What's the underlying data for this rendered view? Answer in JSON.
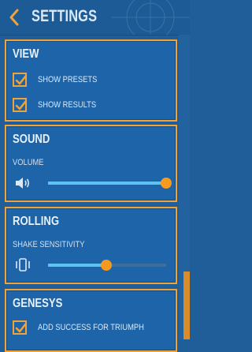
{
  "header": {
    "title": "SETTINGS",
    "back_icon": "chevron-left-icon"
  },
  "colors": {
    "accent": "#f0a33a",
    "background": "#1f5e99",
    "slider_fill": "#5fc3f2",
    "thumb": "#f59a1f"
  },
  "sections": {
    "view": {
      "title": "VIEW",
      "show_presets": {
        "label": "SHOW PRESETS",
        "checked": true
      },
      "show_results": {
        "label": "SHOW RESULTS",
        "checked": true
      }
    },
    "sound": {
      "title": "SOUND",
      "volume_label": "VOLUME",
      "volume_icon": "speaker-icon",
      "volume_value": 1.0
    },
    "rolling": {
      "title": "ROLLING",
      "shake_label": "SHAKE SENSITIVITY",
      "shake_icon": "shaking-phone-icon",
      "shake_value": 0.49
    },
    "genesys": {
      "title": "GENESYS",
      "add_success": {
        "label": "ADD SUCCESS FOR TRIUMPH",
        "checked": true
      }
    }
  }
}
